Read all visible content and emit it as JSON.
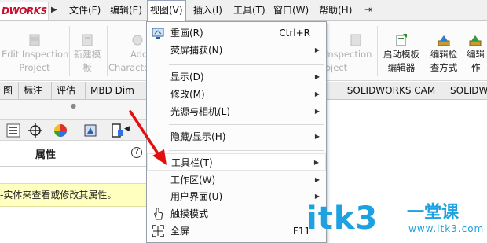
{
  "logo": {
    "text": "DWORKS"
  },
  "menubar": {
    "items": [
      {
        "label": "文件(F)"
      },
      {
        "label": "编辑(E)"
      },
      {
        "label": "视图(V)"
      },
      {
        "label": "插入(I)"
      },
      {
        "label": "工具(T)"
      },
      {
        "label": "窗口(W)"
      },
      {
        "label": "帮助(H)"
      }
    ]
  },
  "ribbon": {
    "edit_inspection": "Edit Inspection",
    "edit_inspection_2": "Project",
    "new_template": "新建模",
    "new_template_2": "板",
    "add_chars": "Add",
    "add_chars_2": "Characte",
    "right_inspection": "Inspection",
    "right_inspection_2": "oject",
    "launch_template": "启动模板",
    "launch_template_2": "编辑器",
    "edit_check": "编辑检",
    "edit_check_2": "查方式",
    "edit_op": "编辑",
    "edit_op_2": "作"
  },
  "tabs": {
    "items": [
      {
        "label": "图"
      },
      {
        "label": "标注"
      },
      {
        "label": "评估"
      },
      {
        "label": "MBD Dim"
      },
      {
        "label": "SOLIDWORKS CAM"
      },
      {
        "label": "SOLIDW"
      }
    ]
  },
  "panel": {
    "title": "属性",
    "help": "?",
    "hint": "-实体来查看或修改其属性。"
  },
  "dropdown": {
    "items": [
      {
        "label": "重画(R)",
        "shortcut": "Ctrl+R"
      },
      {
        "label": "荧屏捕获(N)"
      },
      {
        "label": "显示(D)"
      },
      {
        "label": "修改(M)"
      },
      {
        "label": "光源与相机(L)"
      },
      {
        "label": "隐藏/显示(H)"
      },
      {
        "label": "工具栏(T)"
      },
      {
        "label": "工作区(W)"
      },
      {
        "label": "用户界面(U)"
      },
      {
        "label": "触摸模式"
      },
      {
        "label": "全屏",
        "shortcut": "F11"
      }
    ]
  },
  "watermark": {
    "main": "itk3",
    "cn": "一堂课",
    "url": "www.itk3.com"
  },
  "colors": {
    "accent": "#1da1e0",
    "logo_red": "#c8102e",
    "hint_bg": "#ffffc0",
    "arrow_red": "#e01010"
  }
}
